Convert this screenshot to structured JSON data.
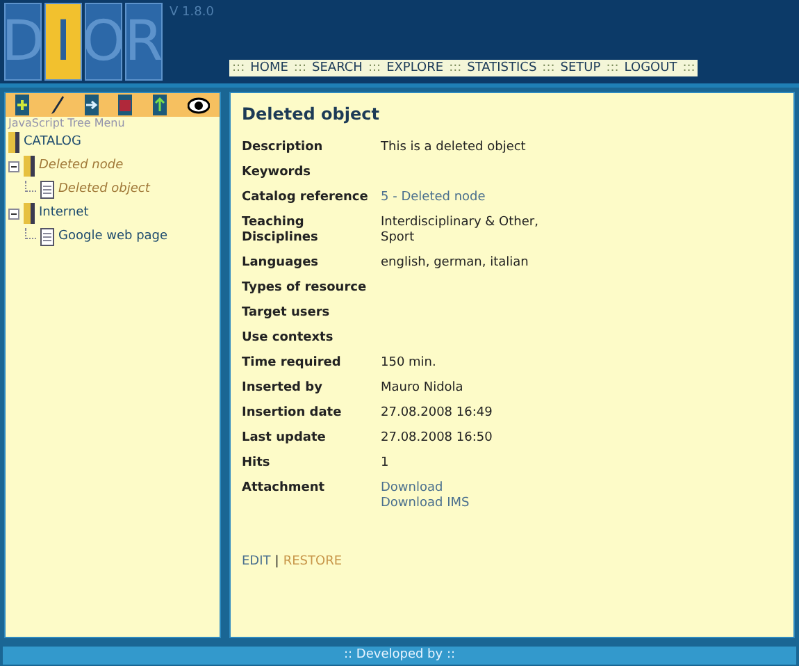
{
  "header": {
    "logo_letters": [
      "D",
      "I",
      "O",
      "R"
    ],
    "version": "V 1.8.0",
    "nav": [
      ":::",
      "HOME",
      ":::",
      "SEARCH",
      ":::",
      "EXPLORE",
      ":::",
      "STATISTICS",
      ":::",
      "SETUP",
      ":::",
      "LOGOUT",
      ":::"
    ]
  },
  "sidebar": {
    "toolbar": [
      {
        "kind": "add"
      },
      {
        "kind": "edit"
      },
      {
        "kind": "move"
      },
      {
        "kind": "delete"
      },
      {
        "kind": "up"
      },
      {
        "kind": "view"
      }
    ],
    "caption": "JavaScript Tree Menu",
    "tree": [
      {
        "label": "CATALOG",
        "kind": "folder",
        "deleted": false,
        "children": [
          {
            "label": "Deleted node",
            "kind": "folder",
            "deleted": true,
            "expanded": true,
            "children": [
              {
                "label": "Deleted object",
                "kind": "page",
                "deleted": true
              }
            ]
          },
          {
            "label": "Internet",
            "kind": "folder",
            "deleted": false,
            "expanded": true,
            "children": [
              {
                "label": "Google web page",
                "kind": "page",
                "deleted": false
              }
            ]
          }
        ]
      }
    ]
  },
  "detail": {
    "title": "Deleted object",
    "fields": [
      {
        "label": "Description",
        "values": [
          "This is a deleted object"
        ],
        "link": false
      },
      {
        "label": "Keywords"
      },
      {
        "label": "Catalog reference",
        "values": [
          "5 - Deleted node"
        ],
        "link": true
      },
      {
        "label": "Teaching Disciplines",
        "values": [
          "Interdisciplinary & Other, Sport"
        ],
        "link": false
      },
      {
        "label": "Languages",
        "values": [
          "english, german, italian"
        ],
        "link": false
      },
      {
        "label": "Types of resource"
      },
      {
        "label": "Target users"
      },
      {
        "label": "Use contexts"
      },
      {
        "label": "Time required",
        "values": [
          "150 min."
        ],
        "link": false
      },
      {
        "label": "Inserted by",
        "values": [
          "Mauro Nidola"
        ],
        "link": false
      },
      {
        "label": "Insertion date",
        "values": [
          "27.08.2008 16:49"
        ],
        "link": false
      },
      {
        "label": "Last update",
        "values": [
          "27.08.2008 16:50"
        ],
        "link": false
      },
      {
        "label": "Hits",
        "values": [
          "1"
        ],
        "link": false
      },
      {
        "label": "Attachment",
        "values": [
          "Download",
          "Download IMS"
        ],
        "link": true
      }
    ],
    "actions": [
      {
        "label": "EDIT",
        "kind": "edit"
      },
      {
        "label": "|",
        "kind": "separator"
      },
      {
        "label": "RESTORE",
        "kind": "restore"
      }
    ]
  },
  "footer": {
    "text": ":: Developed by ::"
  }
}
